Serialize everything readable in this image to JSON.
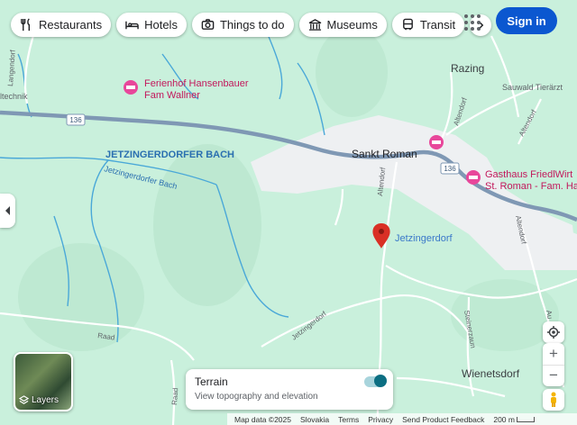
{
  "toolbar": {
    "chips": [
      {
        "label": "Restaurants",
        "icon": "restaurant-icon"
      },
      {
        "label": "Hotels",
        "icon": "hotel-icon"
      },
      {
        "label": "Things to do",
        "icon": "camera-icon"
      },
      {
        "label": "Museums",
        "icon": "museum-icon"
      },
      {
        "label": "Transit",
        "icon": "transit-icon"
      }
    ],
    "more_icon": "chevron-right-icon",
    "apps_icon": "apps-grid-icon",
    "signin_label": "Sign in"
  },
  "map": {
    "places": {
      "razing": "Razing",
      "sankt_roman": "Sankt Roman",
      "wienetsdorf": "Wienetsdorf",
      "jetzingerdorf": "Jetzingerdorf",
      "sauwald": "Sauwald Tierärzt",
      "technik": "ltechnik"
    },
    "pois": {
      "ferienhof_line1": "Ferienhof Hansenbauer",
      "ferienhof_line2": "Fam Wallner",
      "gasthaus_line1": "Gasthaus FriedlWirt",
      "gasthaus_line2": "St. Roman - Fam. Ha"
    },
    "water": {
      "bach_upper": "JETZINGERDORFER BACH",
      "bach_stream": "Jetzingerdorfer Bach"
    },
    "roads": {
      "route_number": "136",
      "route_number_2": "136",
      "altendorf_1": "Altendorf",
      "altendorf_2": "Altendorf",
      "altendorf_3": "Altendorf",
      "altendorf_4": "Altendorf",
      "jetzingerdorf_road": "Jetzingerdorf",
      "raad_1": "Raad",
      "raad_2": "Raad",
      "langendorf": "Langendorf",
      "steinerzaun": "Steinerzaun",
      "au": "Au"
    },
    "pin_label": "Jetzingerdorf"
  },
  "layers": {
    "label": "Layers"
  },
  "terrain": {
    "title": "Terrain",
    "subtitle": "View topography and elevation",
    "enabled": true
  },
  "controls": {
    "zoom_in": "+",
    "zoom_out": "−"
  },
  "footer": {
    "map_data": "Map data ©2025",
    "country": "Slovakia",
    "terms": "Terms",
    "privacy": "Privacy",
    "feedback": "Send Product Feedback",
    "scale": "200 m"
  },
  "colors": {
    "land": "#c9f0dc",
    "water": "#4aa8d8",
    "highway": "#7f98b4",
    "road": "#ffffff",
    "town": "#eef0f2",
    "hotel_pin": "#e8479b",
    "pin": "#d93025",
    "accent": "#0b57d0"
  }
}
